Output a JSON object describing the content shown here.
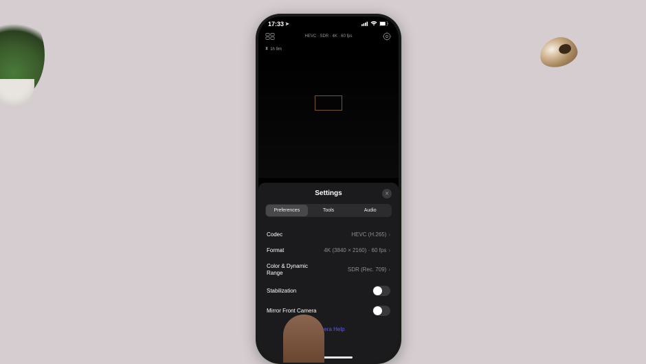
{
  "status": {
    "time": "17:33",
    "location_arrow": "➤"
  },
  "app_header": {
    "format_line": "HEVC · SDR · 4K · 60 fps"
  },
  "timer": {
    "value": "1h 9m"
  },
  "settings": {
    "title": "Settings",
    "tabs": {
      "preferences": "Preferences",
      "tools": "Tools",
      "audio": "Audio"
    },
    "rows": {
      "codec": {
        "label": "Codec",
        "value": "HEVC (H.265)"
      },
      "format": {
        "label": "Format",
        "value": "4K (3840 × 2160) · 60 fps"
      },
      "color": {
        "label": "Color & Dynamic Range",
        "value": "SDR (Rec. 709)"
      },
      "stabilization": {
        "label": "Stabilization",
        "on": false
      },
      "mirror": {
        "label": "Mirror Front Camera",
        "on": false
      }
    },
    "help": "Camera Help"
  }
}
